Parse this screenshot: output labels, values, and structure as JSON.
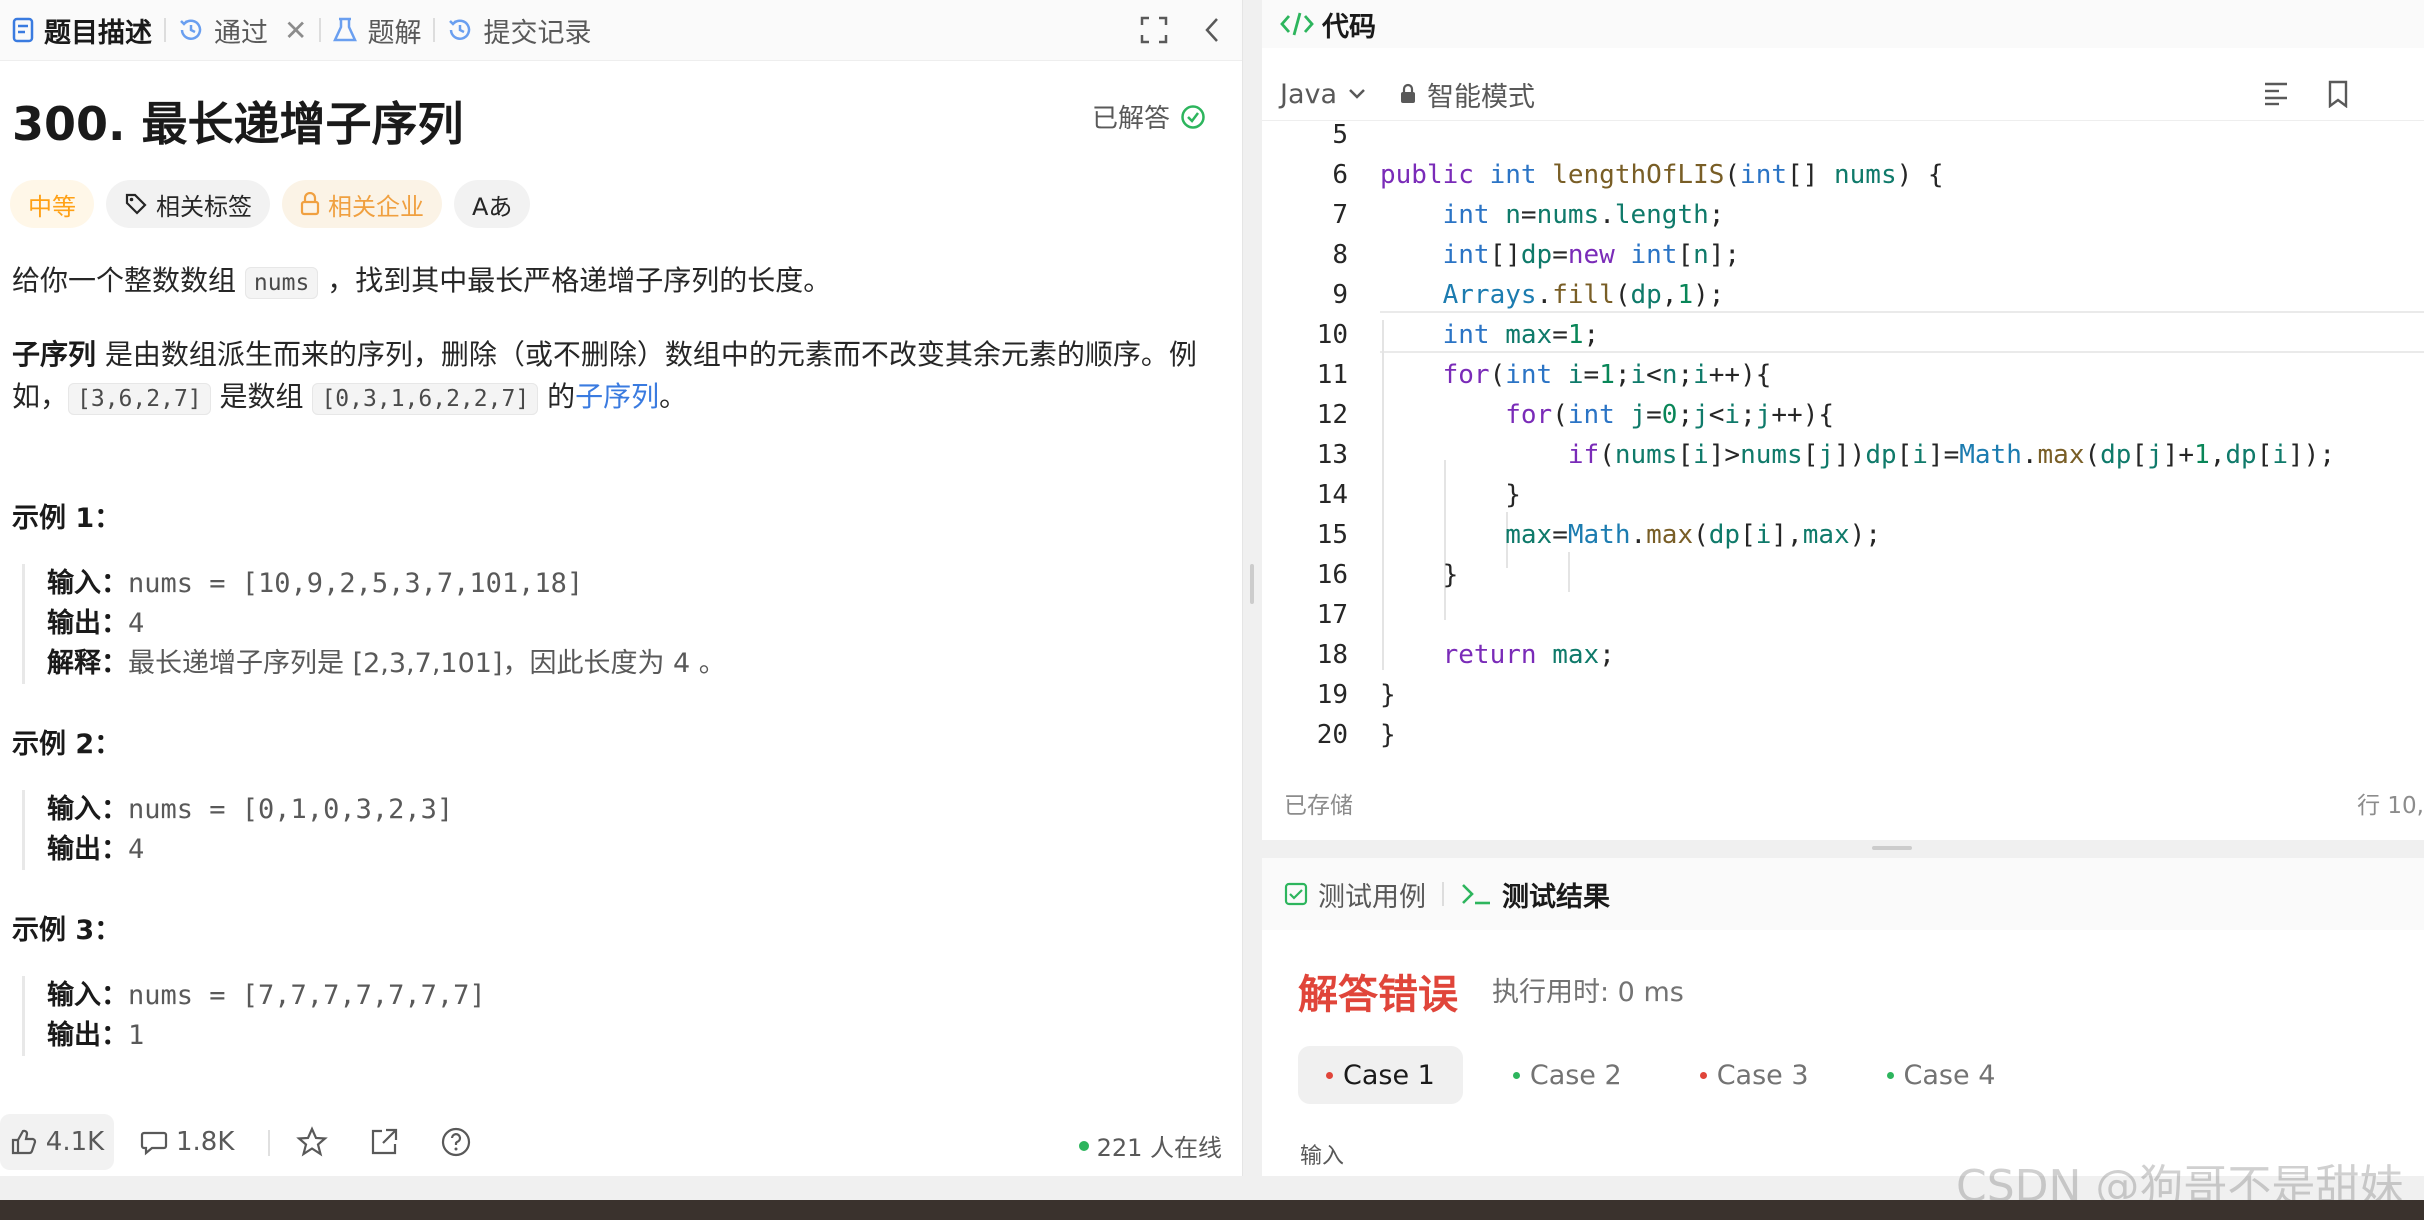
{
  "tabs": [
    {
      "label": "题目描述",
      "active": true,
      "icon": "document-icon"
    },
    {
      "label": "通过",
      "icon": "history-icon",
      "closable": true
    },
    {
      "label": "题解",
      "icon": "flask-icon"
    },
    {
      "label": "提交记录",
      "icon": "history-icon"
    }
  ],
  "problem": {
    "title": "300. 最长递增子序列",
    "status": "已解答",
    "chips": [
      "中等",
      "相关标签",
      "相关企业",
      "Aあ"
    ],
    "desc1_pre": "给你一个整数数组 ",
    "desc1_code": "nums",
    "desc1_post": " ，找到其中最长严格递增子序列的长度。",
    "desc2_bold": "子序列",
    "desc2_text": " 是由数组派生而来的序列，删除（或不删除）数组中的元素而不改变其余元素的顺序。例",
    "desc3_pre": "如，",
    "desc3_code1": "[3,6,2,7]",
    "desc3_mid": " 是数组 ",
    "desc3_code2": "[0,3,1,6,2,2,7]",
    "desc3_of": " 的",
    "desc3_link": "子序列",
    "desc3_end": "。",
    "examples": [
      {
        "title": "示例 1：",
        "lines": [
          {
            "label": "输入：",
            "value": "nums = [10,9,2,5,3,7,101,18]"
          },
          {
            "label": "输出：",
            "value": "4"
          },
          {
            "label": "解释：",
            "value": "最长递增子序列是 [2,3,7,101]，因此长度为 4 。"
          }
        ]
      },
      {
        "title": "示例 2：",
        "lines": [
          {
            "label": "输入：",
            "value": "nums = [0,1,0,3,2,3]"
          },
          {
            "label": "输出：",
            "value": "4"
          }
        ]
      },
      {
        "title": "示例 3：",
        "lines": [
          {
            "label": "输入：",
            "value": "nums = [7,7,7,7,7,7,7]"
          },
          {
            "label": "输出：",
            "value": "1"
          }
        ]
      }
    ]
  },
  "footer": {
    "likes": "4.1K",
    "comments": "1.8K",
    "online": "221 人在线"
  },
  "code": {
    "panel_title": "代码",
    "language": "Java",
    "mode": "智能模式",
    "saved": "已存储",
    "cursor": "行 10,",
    "line_numbers": [
      "5",
      "6",
      "7",
      "8",
      "9",
      "10",
      "11",
      "12",
      "13",
      "14",
      "15",
      "16",
      "17",
      "18",
      "19",
      "20"
    ]
  },
  "result": {
    "tab_testcase": "测试用例",
    "tab_result": "测试结果",
    "verdict": "解答错误",
    "runtime": "执行用时: 0 ms",
    "cases": [
      {
        "label": "Case 1",
        "status_color": "#e0453a",
        "selected": true
      },
      {
        "label": "Case 2",
        "status_color": "#2db55d"
      },
      {
        "label": "Case 3",
        "status_color": "#e0453a"
      },
      {
        "label": "Case 4",
        "status_color": "#2db55d"
      }
    ],
    "input_label": "输入"
  },
  "watermark": "CSDN @狗哥不是甜妹",
  "colors": {
    "accent": "#ffa116",
    "error": "#e0453a",
    "success": "#2db55d",
    "link": "#3a7be0"
  }
}
